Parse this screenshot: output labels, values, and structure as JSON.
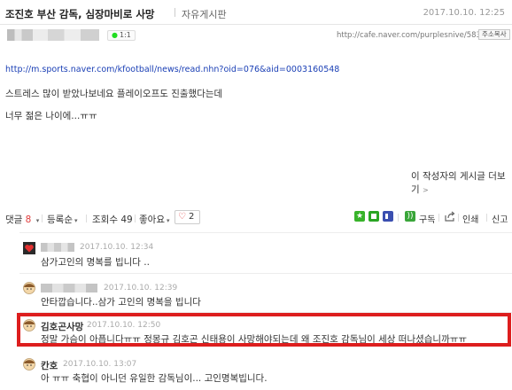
{
  "post": {
    "title": "조진호 부산 감독, 심장마비로 사망",
    "board": "자유게시판",
    "date": "2017.10.10. 12:25",
    "comment_badge_count": "1:1",
    "cafe_url": "http://cafe.naver.com/purplesnive/583",
    "copy_url_label": "주소복사",
    "link": "http://m.sports.naver.com/kfootball/news/read.nhn?oid=076&aid=0003160548",
    "paragraph1": "스트레스 많이 받았나보네요 플레이오프도 진출했다는데",
    "paragraph2": "너무 젊은 나이에...ㅠㅠ",
    "more_posts_label": "이 작성자의 게시글 더보기"
  },
  "toolbar": {
    "comments_label": "댓글",
    "comments_count": "8",
    "sort_label": "등록순",
    "views_label": "조회수",
    "views_count": "49",
    "likes_label": "좋아요",
    "like_count": "2",
    "subscribe_label": "구독",
    "print_label": "인쇄",
    "report_label": "신고"
  },
  "comments": [
    {
      "date": "2017.10.10. 12:34",
      "text": "삼가고인의 명복를 빕니다 .."
    },
    {
      "date": "2017.10.10. 12:39",
      "text": "안타깝습니다..삼가 고인의 명복을 빕니다"
    },
    {
      "name": "김호곤사망",
      "date": "2017.10.10. 12:50",
      "text": "정말 가슴이 아픕니다ㅠㅠ 정몽규 김호곤 신태용이 사망해야되는데 왜 조진호 감독님이 세상 떠나셨습니까ㅠㅠ"
    },
    {
      "name": "칸호",
      "date": "2017.10.10. 13:07",
      "text": "아 ㅠㅠ 축협이 아니던 유일한 감독님이... 고인명복빕니다."
    }
  ],
  "colors": {
    "link": "#1a3fb5",
    "highlight_border": "#dd1e1e",
    "comment_count": "#e03c3c"
  }
}
